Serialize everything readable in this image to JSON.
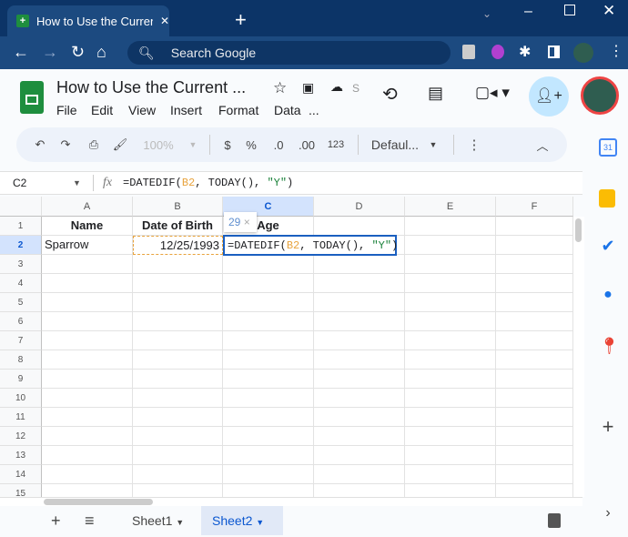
{
  "browser": {
    "tab_title": "How to Use the Current Date in G",
    "search_placeholder": "Search Google",
    "new_tab": "+",
    "close_tab": "✕"
  },
  "doc": {
    "title": "How to Use the Current ...",
    "status_truncated": "S",
    "menus": [
      "File",
      "Edit",
      "View",
      "Insert",
      "Format",
      "Data",
      "..."
    ]
  },
  "toolbar": {
    "zoom": "100%",
    "currency": "$",
    "percent": "%",
    "dec_decrease": ".0",
    "dec_increase": ".00",
    "number_format": "123",
    "font": "Defaul..."
  },
  "formula_bar": {
    "name_box": "C2",
    "fx": "fx",
    "formula_prefix": "=DATEDIF(",
    "formula_ref": "B2",
    "formula_mid": ", TODAY(), ",
    "formula_str": "\"Y\"",
    "formula_end": ")"
  },
  "grid": {
    "columns": [
      "A",
      "B",
      "C",
      "D",
      "E",
      "F"
    ],
    "rows": [
      "1",
      "2",
      "3",
      "4",
      "5",
      "6",
      "7",
      "8",
      "9",
      "10",
      "11",
      "12",
      "13",
      "14",
      "15"
    ],
    "cells": {
      "A1": "Name",
      "B1": "Date of Birth",
      "C1": "Age",
      "A2": "Sparrow",
      "B2": "12/25/1993"
    },
    "preview_value": "29",
    "preview_close": "×"
  },
  "sheets": {
    "add": "+",
    "list": "≡",
    "tabs": [
      "Sheet1",
      "Sheet2"
    ],
    "active": "Sheet2"
  },
  "colors": {
    "chrome": "#0c3467",
    "accent": "#0b57d0",
    "ref": "#e8a33d",
    "string": "#188038"
  }
}
